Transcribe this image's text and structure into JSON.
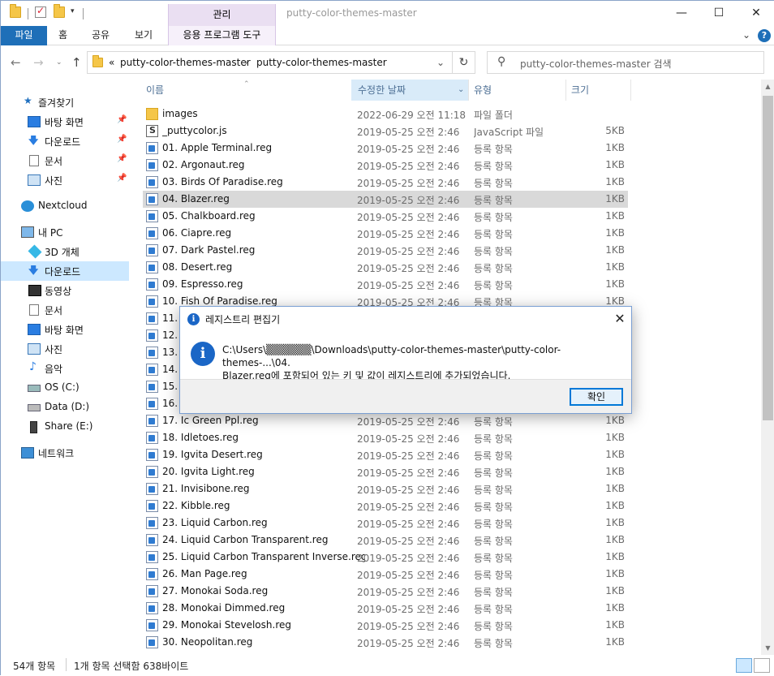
{
  "window": {
    "title": "putty-color-themes-master",
    "context_tab": "관리",
    "minimize": "—",
    "maximize": "☐",
    "close": "✕"
  },
  "ribbon": {
    "file": "파일",
    "tabs": [
      "홈",
      "공유",
      "보기"
    ],
    "context_sub": "응용 프로그램 도구",
    "help": "?"
  },
  "address": {
    "prefix": "«",
    "crumbs": [
      "putty-color-themes-master",
      "putty-color-themes-master"
    ],
    "search_placeholder": "putty-color-themes-master 검색"
  },
  "columns": {
    "name": "이름",
    "date": "수정한 날짜",
    "type": "유형",
    "size": "크기"
  },
  "sidebar": [
    {
      "label": "즐겨찾기",
      "icon": "star-icon"
    },
    {
      "label": "바탕 화면",
      "icon": "desktop-icon",
      "pinned": true
    },
    {
      "label": "다운로드",
      "icon": "download-icon",
      "pinned": true
    },
    {
      "label": "문서",
      "icon": "document-icon",
      "pinned": true
    },
    {
      "label": "사진",
      "icon": "picture-icon",
      "pinned": true
    },
    {
      "label": "Nextcloud",
      "icon": "nextcloud-icon"
    },
    {
      "label": "내 PC",
      "icon": "pc-icon"
    },
    {
      "label": "3D 개체",
      "icon": "cube-icon"
    },
    {
      "label": "다운로드",
      "icon": "download-icon",
      "selected": true
    },
    {
      "label": "동영상",
      "icon": "video-icon"
    },
    {
      "label": "문서",
      "icon": "document-icon"
    },
    {
      "label": "바탕 화면",
      "icon": "desktop-icon"
    },
    {
      "label": "사진",
      "icon": "picture-icon"
    },
    {
      "label": "음악",
      "icon": "music-icon"
    },
    {
      "label": "OS (C:)",
      "icon": "drive-c-icon"
    },
    {
      "label": "Data (D:)",
      "icon": "drive-d-icon"
    },
    {
      "label": "Share (E:)",
      "icon": "drive-e-icon"
    },
    {
      "label": "네트워크",
      "icon": "network-icon"
    }
  ],
  "files": [
    {
      "name": "images",
      "date": "2022-06-29 오전 11:18",
      "type": "파일 폴더",
      "size": "",
      "icon": "folder"
    },
    {
      "name": "_puttycolor.js",
      "date": "2019-05-25 오전 2:46",
      "type": "JavaScript 파일",
      "size": "5KB",
      "icon": "js"
    },
    {
      "name": "01. Apple Terminal.reg",
      "date": "2019-05-25 오전 2:46",
      "type": "등록 항목",
      "size": "1KB",
      "icon": "reg"
    },
    {
      "name": "02. Argonaut.reg",
      "date": "2019-05-25 오전 2:46",
      "type": "등록 항목",
      "size": "1KB",
      "icon": "reg"
    },
    {
      "name": "03. Birds Of Paradise.reg",
      "date": "2019-05-25 오전 2:46",
      "type": "등록 항목",
      "size": "1KB",
      "icon": "reg"
    },
    {
      "name": "04. Blazer.reg",
      "date": "2019-05-25 오전 2:46",
      "type": "등록 항목",
      "size": "1KB",
      "icon": "reg",
      "selected": true
    },
    {
      "name": "05. Chalkboard.reg",
      "date": "2019-05-25 오전 2:46",
      "type": "등록 항목",
      "size": "1KB",
      "icon": "reg"
    },
    {
      "name": "06. Ciapre.reg",
      "date": "2019-05-25 오전 2:46",
      "type": "등록 항목",
      "size": "1KB",
      "icon": "reg"
    },
    {
      "name": "07. Dark Pastel.reg",
      "date": "2019-05-25 오전 2:46",
      "type": "등록 항목",
      "size": "1KB",
      "icon": "reg"
    },
    {
      "name": "08. Desert.reg",
      "date": "2019-05-25 오전 2:46",
      "type": "등록 항목",
      "size": "1KB",
      "icon": "reg"
    },
    {
      "name": "09. Espresso.reg",
      "date": "2019-05-25 오전 2:46",
      "type": "등록 항목",
      "size": "1KB",
      "icon": "reg"
    },
    {
      "name": "10. Fish Of Paradise.reg",
      "date": "2019-05-25 오전 2:46",
      "type": "등록 항목",
      "size": "1KB",
      "icon": "reg"
    },
    {
      "name": "11.",
      "date": "",
      "type": "",
      "size": "",
      "icon": "reg"
    },
    {
      "name": "12.",
      "date": "",
      "type": "",
      "size": "",
      "icon": "reg"
    },
    {
      "name": "13.",
      "date": "",
      "type": "",
      "size": "",
      "icon": "reg"
    },
    {
      "name": "14.",
      "date": "",
      "type": "",
      "size": "",
      "icon": "reg"
    },
    {
      "name": "15.",
      "date": "",
      "type": "",
      "size": "",
      "icon": "reg"
    },
    {
      "name": "16.",
      "date": "",
      "type": "",
      "size": "",
      "icon": "reg"
    },
    {
      "name": "17. Ic Green Ppl.reg",
      "date": "2019-05-25 오전 2:46",
      "type": "등록 항목",
      "size": "1KB",
      "icon": "reg"
    },
    {
      "name": "18. Idletoes.reg",
      "date": "2019-05-25 오전 2:46",
      "type": "등록 항목",
      "size": "1KB",
      "icon": "reg"
    },
    {
      "name": "19. Igvita Desert.reg",
      "date": "2019-05-25 오전 2:46",
      "type": "등록 항목",
      "size": "1KB",
      "icon": "reg"
    },
    {
      "name": "20. Igvita Light.reg",
      "date": "2019-05-25 오전 2:46",
      "type": "등록 항목",
      "size": "1KB",
      "icon": "reg"
    },
    {
      "name": "21. Invisibone.reg",
      "date": "2019-05-25 오전 2:46",
      "type": "등록 항목",
      "size": "1KB",
      "icon": "reg"
    },
    {
      "name": "22. Kibble.reg",
      "date": "2019-05-25 오전 2:46",
      "type": "등록 항목",
      "size": "1KB",
      "icon": "reg"
    },
    {
      "name": "23. Liquid Carbon.reg",
      "date": "2019-05-25 오전 2:46",
      "type": "등록 항목",
      "size": "1KB",
      "icon": "reg"
    },
    {
      "name": "24. Liquid Carbon Transparent.reg",
      "date": "2019-05-25 오전 2:46",
      "type": "등록 항목",
      "size": "1KB",
      "icon": "reg"
    },
    {
      "name": "25. Liquid Carbon Transparent Inverse.reg",
      "date": "2019-05-25 오전 2:46",
      "type": "등록 항목",
      "size": "1KB",
      "icon": "reg"
    },
    {
      "name": "26. Man Page.reg",
      "date": "2019-05-25 오전 2:46",
      "type": "등록 항목",
      "size": "1KB",
      "icon": "reg"
    },
    {
      "name": "27. Monokai Soda.reg",
      "date": "2019-05-25 오전 2:46",
      "type": "등록 항목",
      "size": "1KB",
      "icon": "reg"
    },
    {
      "name": "28. Monokai Dimmed.reg",
      "date": "2019-05-25 오전 2:46",
      "type": "등록 항목",
      "size": "1KB",
      "icon": "reg"
    },
    {
      "name": "29. Monokai Stevelosh.reg",
      "date": "2019-05-25 오전 2:46",
      "type": "등록 항목",
      "size": "1KB",
      "icon": "reg"
    },
    {
      "name": "30. Neopolitan.reg",
      "date": "2019-05-25 오전 2:46",
      "type": "등록 항목",
      "size": "1KB",
      "icon": "reg"
    }
  ],
  "status": {
    "count": "54개 항목",
    "selection": "1개 항목 선택함 638바이트"
  },
  "dialog": {
    "title": "레지스트리 편집기",
    "message_line1": "C:\\Users\\▒▒▒▒▒▒\\Downloads\\putty-color-themes-master\\putty-color-themes-...\\04.",
    "message_line2": "Blazer.reg에 포함되어 있는 키 및 값이 레지스트리에 추가되었습니다.",
    "ok": "확인",
    "close": "✕",
    "info_glyph": "i"
  },
  "colors": {
    "accent": "#1e6fb8",
    "selected_row": "#d9d9d9",
    "sidebar_selected": "#cce8ff",
    "context_tab": "#eadff2"
  }
}
